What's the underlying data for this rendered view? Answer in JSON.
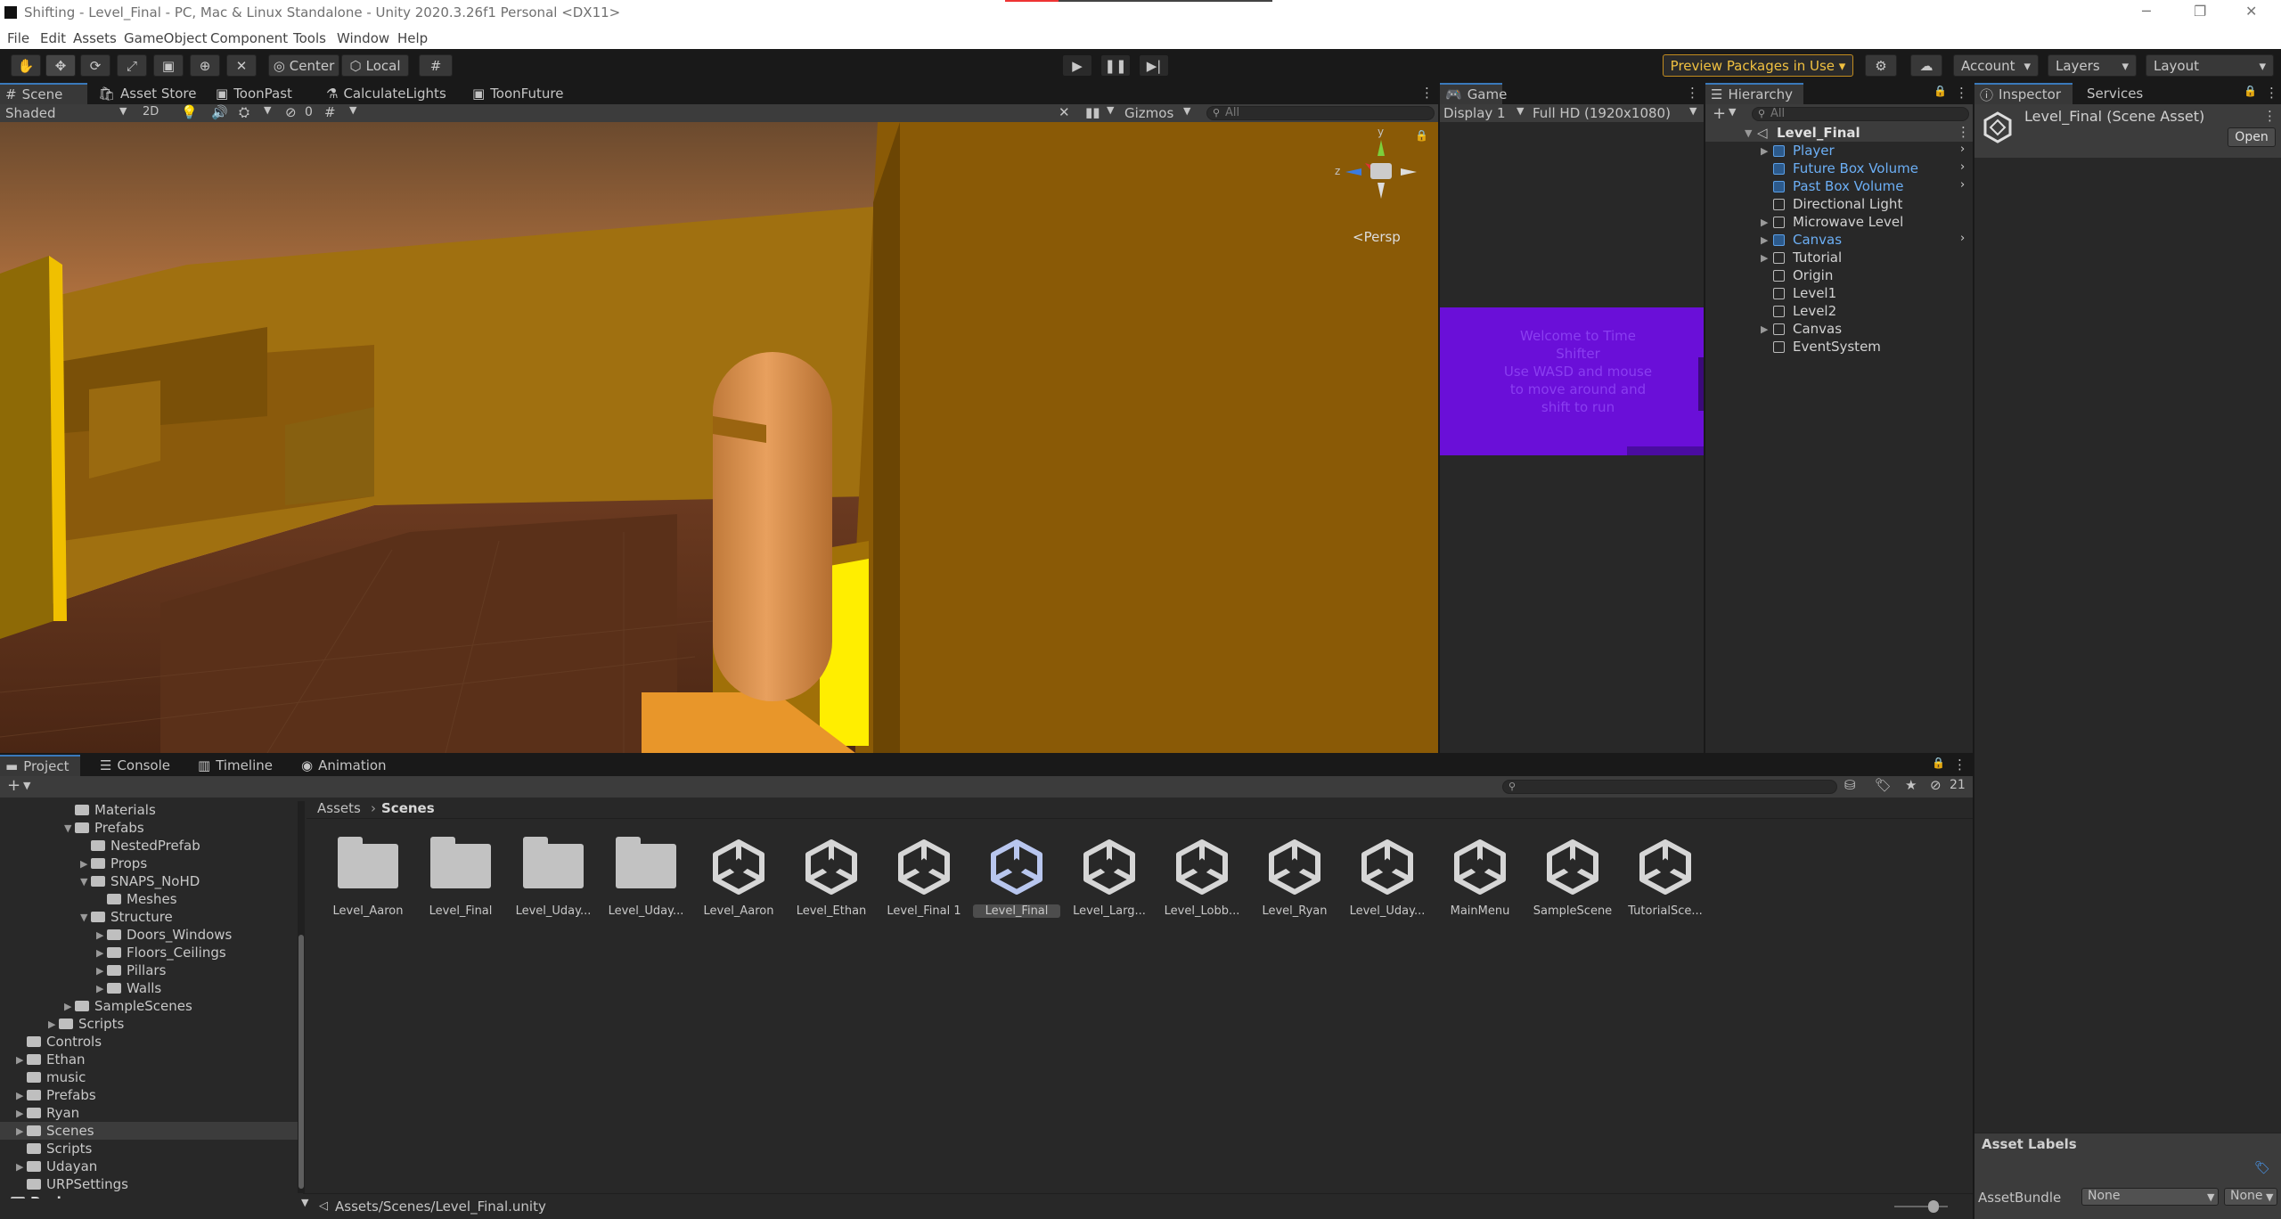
{
  "window": {
    "title": "Shifting - Level_Final - PC, Mac & Linux Standalone - Unity 2020.3.26f1 Personal <DX11>"
  },
  "menu": [
    "File",
    "Edit",
    "Assets",
    "GameObject",
    "Component",
    "Tools",
    "Window",
    "Help"
  ],
  "toolbar": {
    "pivot": "Center",
    "space": "Local",
    "preview_packages": "Preview Packages in Use ▾",
    "account": "Account",
    "layers": "Layers",
    "layout": "Layout"
  },
  "scene_tabs": [
    "Scene",
    "Asset Store",
    "ToonPast",
    "CalculateLights",
    "ToonFuture"
  ],
  "scene_bar": {
    "shading": "Shaded",
    "mode2d": "2D",
    "hidden_count": "0",
    "gizmos": "Gizmos",
    "search_placeholder": "All",
    "persp": "Persp",
    "gizmo_axes": {
      "y": "y",
      "z": "z"
    }
  },
  "game": {
    "tab": "Game",
    "display": "Display 1",
    "resolution": "Full HD (1920x1080)",
    "overlay_text": "Welcome to Time Shifter\nUse WASD and mouse to move around and shift to run"
  },
  "hierarchy": {
    "tab": "Hierarchy",
    "search_placeholder": "All",
    "scene": "Level_Final",
    "items": [
      {
        "label": "Player",
        "blue": true,
        "expand": true,
        "more": true
      },
      {
        "label": "Future Box Volume",
        "blue": true,
        "expand": false,
        "more": true
      },
      {
        "label": "Past Box Volume",
        "blue": true,
        "expand": false,
        "more": true
      },
      {
        "label": "Directional Light",
        "blue": false,
        "expand": false,
        "more": false
      },
      {
        "label": "Microwave Level",
        "blue": false,
        "expand": true,
        "more": false
      },
      {
        "label": "Canvas",
        "blue": true,
        "expand": true,
        "more": true
      },
      {
        "label": "Tutorial",
        "blue": false,
        "expand": true,
        "more": false
      },
      {
        "label": "Origin",
        "blue": false,
        "expand": false,
        "more": false
      },
      {
        "label": "Level1",
        "blue": false,
        "expand": false,
        "more": false
      },
      {
        "label": "Level2",
        "blue": false,
        "expand": false,
        "more": false
      },
      {
        "label": "Canvas",
        "blue": false,
        "expand": true,
        "more": false
      },
      {
        "label": "EventSystem",
        "blue": false,
        "expand": false,
        "more": false
      }
    ]
  },
  "inspector": {
    "tabs": [
      "Inspector",
      "Services"
    ],
    "title": "Level_Final (Scene Asset)",
    "open": "Open",
    "asset_labels": "Asset Labels",
    "assetbundle_label": "AssetBundle",
    "assetbundle_value": "None",
    "variant_value": "None"
  },
  "project": {
    "tabs": [
      "Project",
      "Console",
      "Timeline",
      "Animation"
    ],
    "hidden_count": "21",
    "breadcrumb": [
      "Assets",
      "Scenes"
    ],
    "status_path": "Assets/Scenes/Level_Final.unity",
    "tree": [
      {
        "label": "Materials",
        "indent": 4,
        "arrow": ""
      },
      {
        "label": "Prefabs",
        "indent": 4,
        "arrow": "▼",
        "open": true
      },
      {
        "label": "NestedPrefab",
        "indent": 5,
        "arrow": ""
      },
      {
        "label": "Props",
        "indent": 5,
        "arrow": "▶"
      },
      {
        "label": "SNAPS_NoHD",
        "indent": 5,
        "arrow": "▼",
        "open": true
      },
      {
        "label": "Meshes",
        "indent": 6,
        "arrow": ""
      },
      {
        "label": "Structure",
        "indent": 5,
        "arrow": "▼",
        "open": true
      },
      {
        "label": "Doors_Windows",
        "indent": 6,
        "arrow": "▶"
      },
      {
        "label": "Floors_Ceilings",
        "indent": 6,
        "arrow": "▶"
      },
      {
        "label": "Pillars",
        "indent": 6,
        "arrow": "▶"
      },
      {
        "label": "Walls",
        "indent": 6,
        "arrow": "▶"
      },
      {
        "label": "SampleScenes",
        "indent": 4,
        "arrow": "▶"
      },
      {
        "label": "Scripts",
        "indent": 3,
        "arrow": "▶"
      },
      {
        "label": "Controls",
        "indent": 1,
        "arrow": ""
      },
      {
        "label": "Ethan",
        "indent": 1,
        "arrow": "▶"
      },
      {
        "label": "music",
        "indent": 1,
        "arrow": ""
      },
      {
        "label": "Prefabs",
        "indent": 1,
        "arrow": "▶"
      },
      {
        "label": "Ryan",
        "indent": 1,
        "arrow": "▶"
      },
      {
        "label": "Scenes",
        "indent": 1,
        "arrow": "▶",
        "selected": true
      },
      {
        "label": "Scripts",
        "indent": 1,
        "arrow": ""
      },
      {
        "label": "Udayan",
        "indent": 1,
        "arrow": "▶"
      },
      {
        "label": "URPSettings",
        "indent": 1,
        "arrow": ""
      },
      {
        "label": "Packages",
        "indent": 0,
        "arrow": "▶",
        "bold": true
      }
    ],
    "assets": [
      {
        "label": "Level_Aaron",
        "kind": "folder"
      },
      {
        "label": "Level_Final",
        "kind": "folder"
      },
      {
        "label": "Level_Uday...",
        "kind": "folder"
      },
      {
        "label": "Level_Uday...",
        "kind": "folder"
      },
      {
        "label": "Level_Aaron",
        "kind": "scene"
      },
      {
        "label": "Level_Ethan",
        "kind": "scene"
      },
      {
        "label": "Level_Final 1",
        "kind": "scene"
      },
      {
        "label": "Level_Final",
        "kind": "scene",
        "selected": true
      },
      {
        "label": "Level_Larg...",
        "kind": "scene"
      },
      {
        "label": "Level_Lobb...",
        "kind": "scene"
      },
      {
        "label": "Level_Ryan",
        "kind": "scene"
      },
      {
        "label": "Level_Uday...",
        "kind": "scene"
      },
      {
        "label": "MainMenu",
        "kind": "scene"
      },
      {
        "label": "SampleScene",
        "kind": "scene"
      },
      {
        "label": "TutorialSce...",
        "kind": "scene"
      }
    ]
  },
  "colors": {
    "accent": "#3a79bb",
    "prefab_blue": "#6caff5",
    "game_purple": "#6a0fd8",
    "scene_sky": "#e89a52"
  }
}
